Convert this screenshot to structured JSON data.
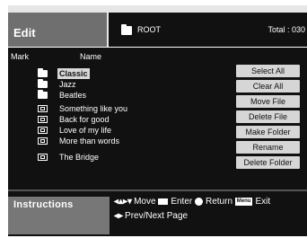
{
  "header": {
    "title": "Edit",
    "location": "ROOT",
    "total": "Total : 030"
  },
  "list": {
    "column_mark": "Mark",
    "column_name": "Name",
    "folders": [
      "Classic",
      "Jazz",
      "Beatles"
    ],
    "songs": [
      "Something like you",
      "Back for good",
      "Love of my life",
      "More than words",
      "The Bridge"
    ],
    "selected": "Classic"
  },
  "buttons": {
    "select_all": "Select All",
    "clear_all": "Clear All",
    "move_file": "Move File",
    "delete_file": "Delete File",
    "make_folder": "Make Folder",
    "rename": "Rename",
    "delete_folder": "Delete Folder"
  },
  "instructions": {
    "title": "Instructions",
    "move_key": "◂▴▸▾",
    "move": "Move",
    "enter": "Enter",
    "return": "Return",
    "menu_key": "Menu",
    "exit": "Exit",
    "prev_next_key": "◂▸",
    "prev_next": "Prev/Next Page"
  }
}
